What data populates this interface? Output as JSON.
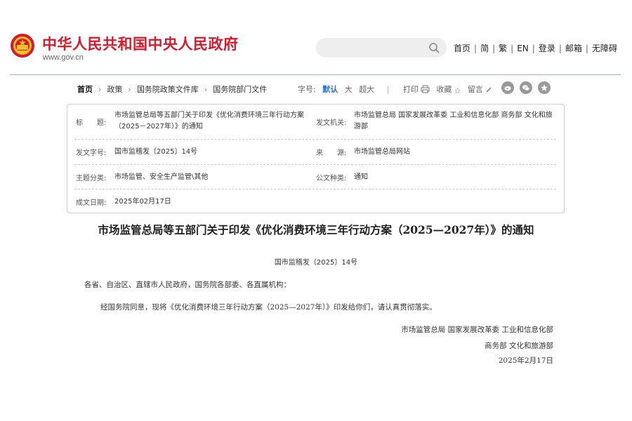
{
  "header": {
    "title": "中华人民共和国中央人民政府",
    "url": "www.gov.cn",
    "search_placeholder": "",
    "nav": [
      "首页",
      "简",
      "繁",
      "EN",
      "登录",
      "邮箱",
      "无障碍"
    ],
    "brand_color": "#d8192b"
  },
  "breadcrumb": [
    "首页",
    "政策",
    "国务院政策文件库",
    "国务院部门文件"
  ],
  "tools": {
    "font_label": "字号:",
    "font_default": "默认",
    "font_large": "大",
    "font_xlarge": "超大",
    "print": "打印",
    "favorite": "收藏",
    "comment": "留言",
    "icons": [
      "weibo-icon",
      "wechat-icon",
      "qzone-icon"
    ]
  },
  "meta": {
    "title_label": "标　　题:",
    "title_value": "市场监管总局等五部门关于印发《优化消费环境三年行动方案（2025－2027年）》的通知",
    "issuer_label": "发文机关:",
    "issuer_value": "市场监管总局 国家发展改革委 工业和信息化部 商务部 文化和旅游部",
    "docno_label": "发文字号:",
    "docno_value": "国市监稽发〔2025〕14号",
    "source_label": "来　　源:",
    "source_value": "市场监管总局网站",
    "topic_label": "主题分类:",
    "topic_value": "市场监管、安全生产监管\\其他",
    "type_label": "公文种类:",
    "type_value": "通知",
    "date_label": "成文日期:",
    "date_value": "2025年02月17日"
  },
  "document": {
    "title": "市场监管总局等五部门关于印发《优化消费环境三年行动方案（2025—2027年）》的通知",
    "doc_no": "国市监稽发〔2025〕14号",
    "addressee": "各省、自治区、直辖市人民政府，国务院各部委、各直属机构：",
    "paragraph": "经国务院同意，现将《优化消费环境三年行动方案（2025—2027年）》印发给你们，请认真贯彻落实。",
    "signature_line1": "市场监管总局 国家发展改革委 工业和信息化部",
    "signature_line2": "商务部 文化和旅游部",
    "signature_date": "2025年2月17日"
  }
}
